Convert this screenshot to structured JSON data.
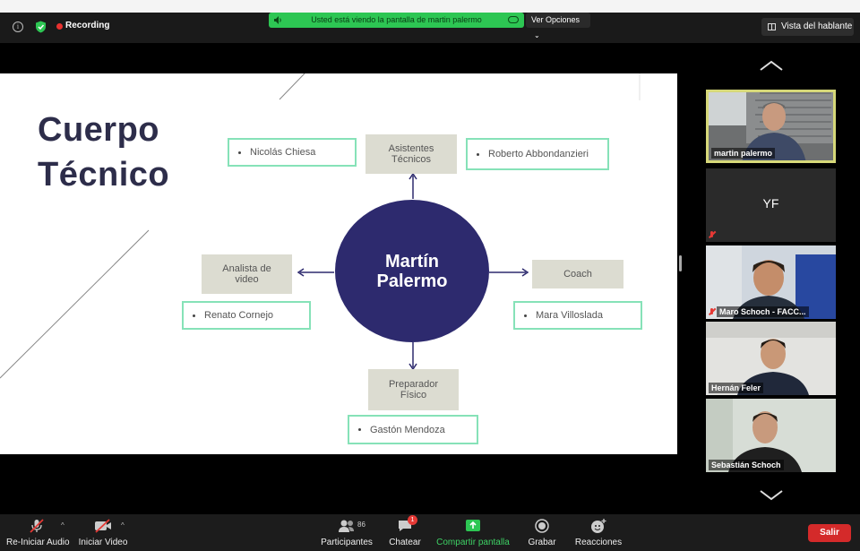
{
  "topbar": {
    "recording_label": "Recording",
    "share_banner_text": "Usted está viendo la pantalla de martin palermo",
    "view_options_label": "Ver Opciones",
    "speaker_view_label": "Vista del hablante"
  },
  "slide": {
    "title_line1": "Cuerpo",
    "title_line2": "Técnico",
    "center_line1": "Martín",
    "center_line2": "Palermo",
    "asistentes": "Asistentes Técnicos",
    "asistente_left": "Nicolás Chiesa",
    "asistente_right": "Roberto Abbondanzieri",
    "analista": "Analista de video",
    "analista_name": "Renato Cornejo",
    "coach": "Coach",
    "coach_name": "Mara Villoslada",
    "preparador": "Preparador Físico",
    "preparador_name": "Gastón Mendoza"
  },
  "gallery": {
    "tiles": [
      {
        "name": "martin palermo"
      },
      {
        "name": "",
        "initials": "YF"
      },
      {
        "name": "Maro Schoch - FACC..."
      },
      {
        "name": "Hernán Feler"
      },
      {
        "name": "Sebastián Schoch"
      }
    ]
  },
  "toolbar": {
    "audio_label": "Re-Iniciar Audio",
    "video_label": "Iniciar Video",
    "participants_label": "Participantes",
    "participants_count": "86",
    "chat_label": "Chatear",
    "chat_badge": "1",
    "share_label": "Compartir pantalla",
    "record_label": "Grabar",
    "reactions_label": "Reacciones",
    "exit_label": "Salir"
  },
  "colors": {
    "share_green": "#2dc653",
    "circle_navy": "#2d2a6e",
    "box_gray": "#dcdcd1",
    "box_border_green": "#86e2b8",
    "active_speaker_border": "#d6d879",
    "exit_red": "#d42a2a"
  }
}
